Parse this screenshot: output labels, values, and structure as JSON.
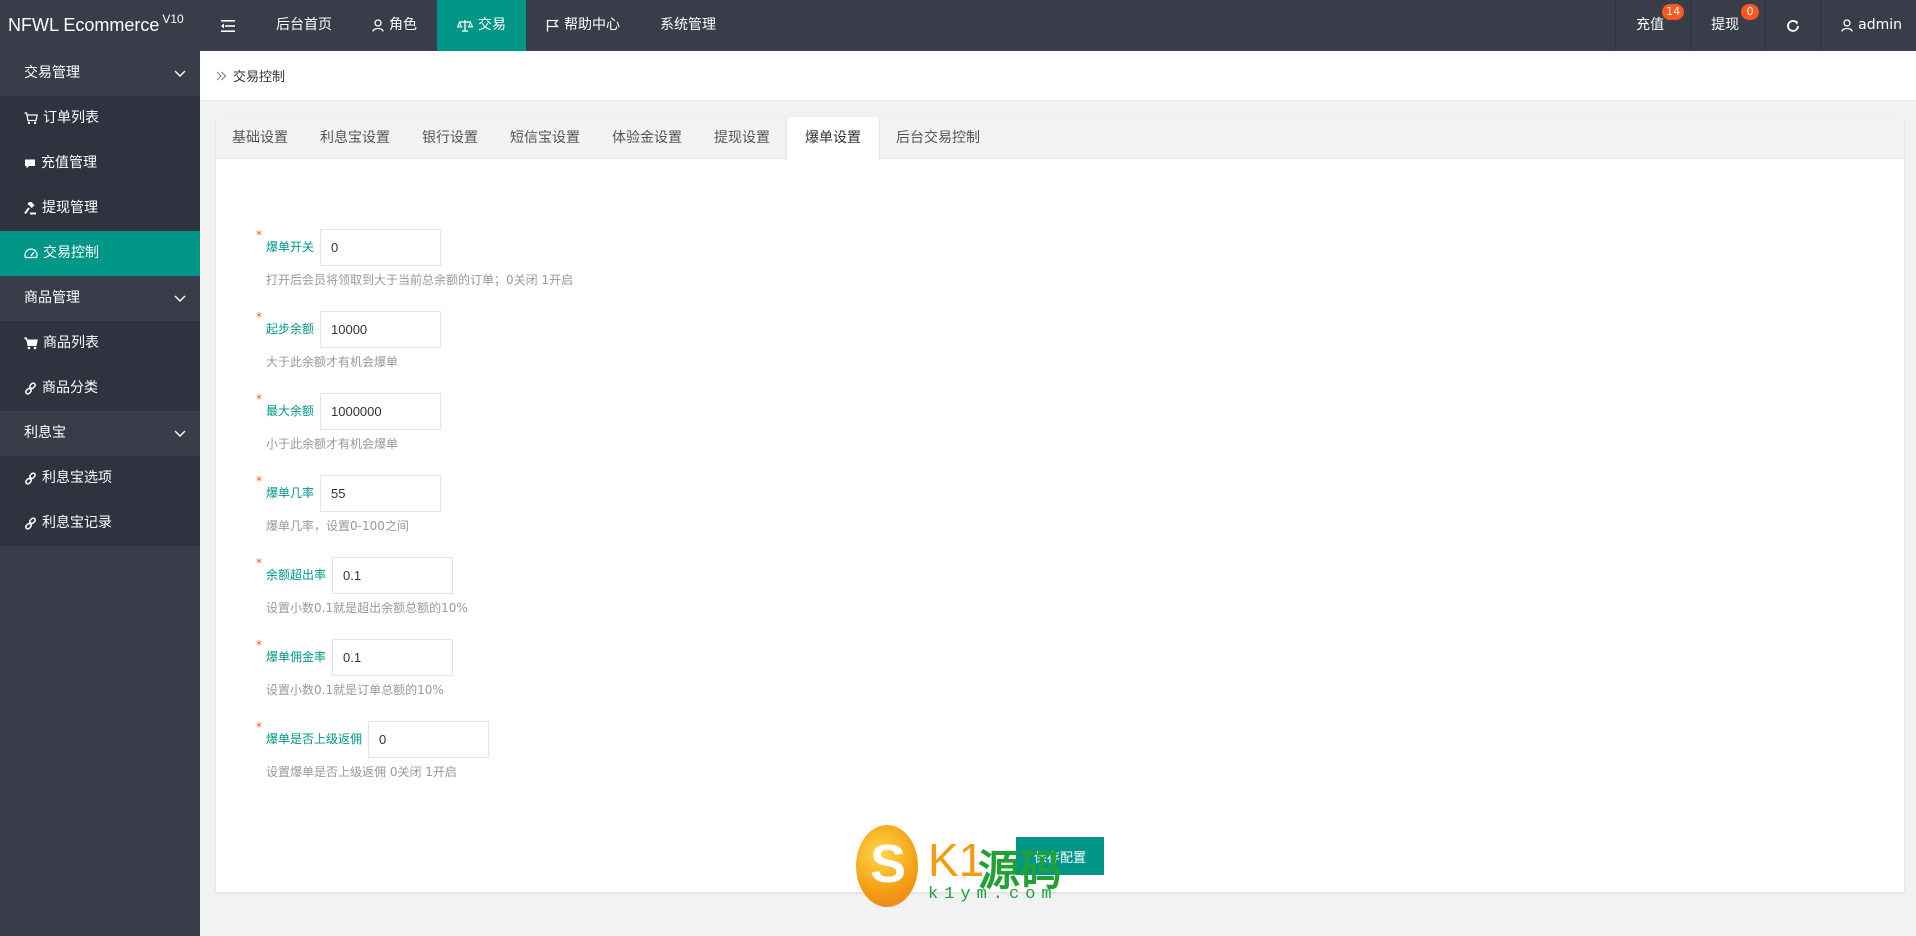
{
  "app": {
    "title": "NFWL Ecommerce",
    "version": "V10"
  },
  "topnav": {
    "items": [
      {
        "label": "后台首页"
      },
      {
        "label": "角色"
      },
      {
        "label": "交易"
      },
      {
        "label": "帮助中心"
      },
      {
        "label": "系统管理"
      }
    ],
    "active": "交易",
    "right": {
      "recharge_label": "充值",
      "recharge_badge": "14",
      "withdraw_label": "提现",
      "withdraw_badge": "0",
      "user_label": "admin"
    }
  },
  "sidebar": {
    "groups": [
      {
        "label": "交易管理",
        "items": [
          "订单列表",
          "充值管理",
          "提现管理",
          "交易控制"
        ]
      },
      {
        "label": "商品管理",
        "items": [
          "商品列表",
          "商品分类"
        ]
      },
      {
        "label": "利息宝",
        "items": [
          "利息宝选项",
          "利息宝记录"
        ]
      }
    ],
    "active_item": "交易控制"
  },
  "breadcrumb": {
    "current": "交易控制"
  },
  "tabs": {
    "items": [
      "基础设置",
      "利息宝设置",
      "银行设置",
      "短信宝设置",
      "体验金设置",
      "提现设置",
      "爆单设置",
      "后台交易控制"
    ],
    "active": "爆单设置"
  },
  "form": {
    "required_mark": "*",
    "fields": [
      {
        "label": "爆单开关",
        "value": "0",
        "hint": "打开后会员将领取到大于当前总余额的订单；0关闭 1开启"
      },
      {
        "label": "起步余额",
        "value": "10000",
        "hint": "大于此余额才有机会爆单"
      },
      {
        "label": "最大余额",
        "value": "1000000",
        "hint": "小于此余额才有机会爆单"
      },
      {
        "label": "爆单几率",
        "value": "55",
        "hint": "爆单几率，设置0-100之间"
      },
      {
        "label": "余额超出率",
        "value": "0.1",
        "hint": "设置小数0.1就是超出余额总额的10%"
      },
      {
        "label": "爆单佣金率",
        "value": "0.1",
        "hint": "设置小数0.1就是订单总额的10%"
      },
      {
        "label": "爆单是否上级返佣",
        "value": "0",
        "hint": "设置爆单是否上级返佣 0关闭 1开启"
      }
    ],
    "save_label": "保存配置"
  },
  "watermark": {
    "brand_letter": "S",
    "brand_k": "K1",
    "brand_cn": "源码",
    "url": "k1ym.com"
  },
  "colors": {
    "dark": "#393d49",
    "darker": "#2f3340",
    "accent": "#009688",
    "badge": "#ff5722"
  }
}
